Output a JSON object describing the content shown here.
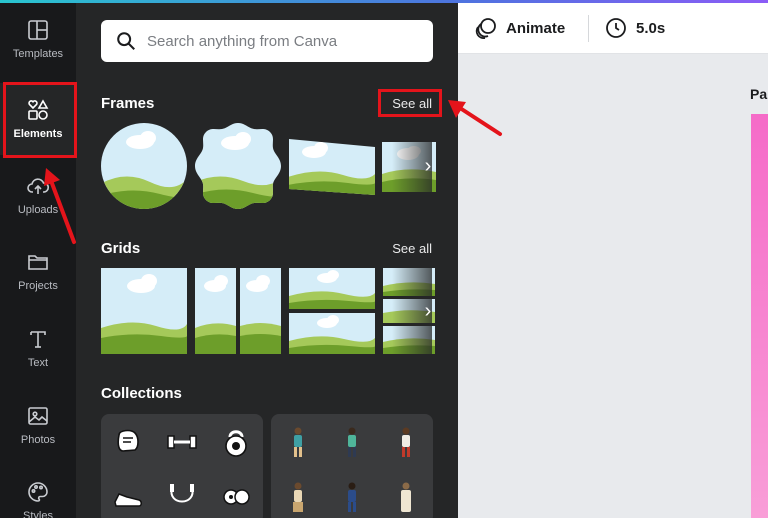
{
  "rail": {
    "items": [
      {
        "label": "Templates",
        "icon": "templates-icon"
      },
      {
        "label": "Elements",
        "icon": "elements-icon",
        "active": true
      },
      {
        "label": "Uploads",
        "icon": "upload-cloud-icon"
      },
      {
        "label": "Projects",
        "icon": "folder-icon"
      },
      {
        "label": "Text",
        "icon": "text-icon"
      },
      {
        "label": "Photos",
        "icon": "image-icon"
      },
      {
        "label": "Styles",
        "icon": "palette-icon"
      }
    ]
  },
  "search": {
    "placeholder": "Search anything from Canva",
    "value": ""
  },
  "sections": {
    "frames": {
      "title": "Frames",
      "see_all": "See all"
    },
    "grids": {
      "title": "Grids",
      "see_all": "See all"
    },
    "collections": {
      "title": "Collections"
    }
  },
  "topbar": {
    "animate_label": "Animate",
    "duration_label": "5.0s"
  },
  "canvas": {
    "page_label": "Pa"
  },
  "colors": {
    "annotation": "#e4141b",
    "panel_bg": "#252627",
    "rail_bg": "#18191b",
    "page_pink": "#f56bc8"
  }
}
